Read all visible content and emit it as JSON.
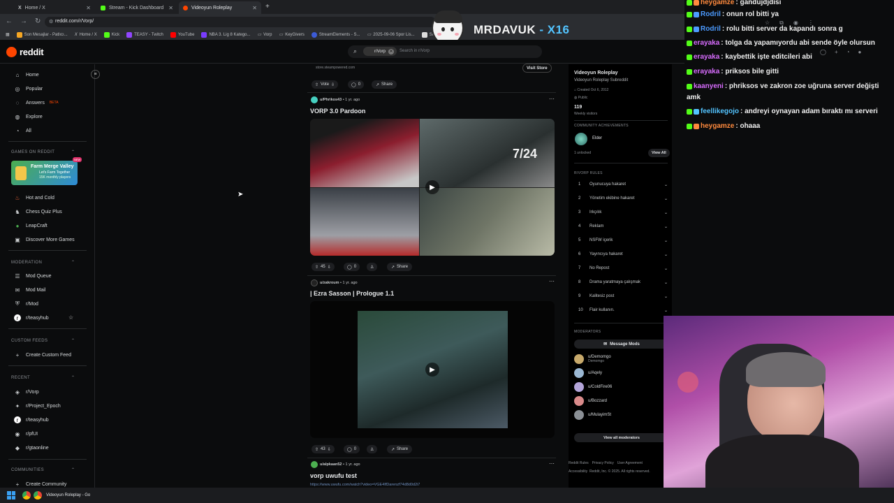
{
  "browser": {
    "tabs": [
      {
        "label": "Home / X"
      },
      {
        "label": "Stream - Kick Dashboard"
      },
      {
        "label": "Videoyun Roleplay"
      }
    ],
    "url": "reddit.com/r/Vorp/",
    "bookmarks": [
      "Son Mesajlar - Patlıcı...",
      "Home / X",
      "Kick",
      "TEASY - Twitch",
      "YouTube",
      "NBA 3. Lig 8 Katego...",
      "Vorp",
      "KeyGivers",
      "StreamElements - S...",
      "2025-09-06 Spor Lis...",
      "Sony..."
    ]
  },
  "overlay": {
    "streamer": "MRDAVUK",
    "suffix": "- X16"
  },
  "reddit": {
    "logo": "reddit",
    "search_chip": "r/Vorp",
    "search_placeholder": "Search in r/Vorp",
    "nav": {
      "home": "Home",
      "popular": "Popular",
      "answers": "Answers",
      "beta": "BETA",
      "explore": "Explore",
      "all": "All"
    },
    "games": {
      "title": "GAMES ON REDDIT",
      "banner_title": "Farm Merge Valley",
      "banner_sub": "Let's Farm Together",
      "banner_sub2": "15K monthly players",
      "new_badge": "NEW",
      "items": [
        "Hot and Cold",
        "Chess Quiz Plus",
        "LeapCraft",
        "Discover More Games"
      ]
    },
    "moderation": {
      "title": "MODERATION",
      "items": [
        "Mod Queue",
        "Mod Mail",
        "r/Mod",
        "r/teasyhub"
      ]
    },
    "custom_feeds": {
      "title": "CUSTOM FEEDS",
      "create": "Create Custom Feed"
    },
    "recent": {
      "title": "RECENT",
      "items": [
        "r/Vorp",
        "r/Project_Epoch",
        "r/teasyhub",
        "r/pfUI",
        "r/gtaonline"
      ]
    },
    "communities": {
      "title": "COMMUNITIES",
      "create": "Create Community"
    },
    "feed": {
      "ad_domain": "store.steampowered.com",
      "visit_store": "Visit Store",
      "vote": "Vote",
      "ad_comments": "0",
      "share": "Share",
      "posts": [
        {
          "author": "u/Phrikos43",
          "time": "1 yr. ago",
          "title": "VORP 3.0 Pardoon",
          "votes": "45",
          "comments": "0",
          "overlay_text": "7/24"
        },
        {
          "author": "u/zakroum",
          "time": "1 yr. ago",
          "title": "| Ezra Sasson | Prologue 1.1",
          "votes": "43",
          "comments": "0"
        },
        {
          "author": "u/alpkaan52",
          "time": "1 yr. ago",
          "title": "vorp uwufu test",
          "link": "https://www.uwufu.com/watch?video=VGE4IfDarenzf74d8d0d2i7"
        }
      ]
    },
    "sidebar": {
      "name": "Videoyun Roleplay",
      "description": "Videoyun Roleplay Subreddit",
      "created": "Created Oct 6, 2012",
      "visibility": "Public",
      "visitors": "119",
      "visitors_label": "Weekly visitors",
      "achievements_title": "COMMUNITY ACHIEVEMENTS",
      "achievement": "Elder",
      "unlocked": "1 unlocked",
      "view_all": "View All",
      "rules_title": "R/VORP RULES",
      "rules": [
        "Oyunucuya hakaret",
        "Yönetim ekibine hakaret",
        "Irkçılık",
        "Reklam",
        "NSFW içerik",
        "Yayıncıya hakaret",
        "No Repost",
        "Drama yaratmaya çalışmak",
        "Kalitesiz post",
        "Flair kullanın."
      ],
      "moderators_title": "MODERATORS",
      "message_mods": "Message Mods",
      "mods": [
        {
          "name": "u/Demomgo",
          "sub": "Demomgo"
        },
        {
          "name": "u/Aqely",
          "sub": ""
        },
        {
          "name": "u/ColdFire06",
          "sub": ""
        },
        {
          "name": "u/Bozzard",
          "sub": ""
        },
        {
          "name": "u/MulayimSt",
          "sub": ""
        }
      ],
      "view_all_mods": "View all moderators",
      "footer1": [
        "Reddit Rules",
        "Privacy Policy",
        "User Agreement"
      ],
      "footer2": "Accessibility  Reddit, Inc. © 2025. All rights reserved."
    }
  },
  "chat": [
    {
      "user": "heygamze",
      "msg": " : gandujdjdisi",
      "color": "#ff8a3d"
    },
    {
      "user": "Rodril",
      "msg": " : onun rol bitti ya",
      "color": "#4c9bff"
    },
    {
      "user": "Rodril",
      "msg": " : rolu bitti server da kapandı sonra g",
      "color": "#4c9bff"
    },
    {
      "user": "erayaka",
      "msg": " : tolga da yapamıyordu abi sende öyle olursun",
      "color": "#d96dff"
    },
    {
      "user": "erayaka",
      "msg": " : kaybettik işte editcileri abi",
      "color": "#d96dff"
    },
    {
      "user": "erayaka",
      "msg": " : priksos bile gitti",
      "color": "#d96dff"
    },
    {
      "user": "kaanyeni",
      "msg": " : phriksos ve zakron zoe uğruna server değişti",
      "color": "#d96dff",
      "cont": "amk"
    },
    {
      "user": "feellikegojo",
      "msg": " : andreyi oynayan adam bıraktı mı serveri",
      "color": "#53c4ff"
    },
    {
      "user": "heygamze",
      "msg": " : ohaaa",
      "color": "#ff8a3d"
    }
  ],
  "taskbar": {
    "app": "Videoyun Roleplay - Go"
  }
}
